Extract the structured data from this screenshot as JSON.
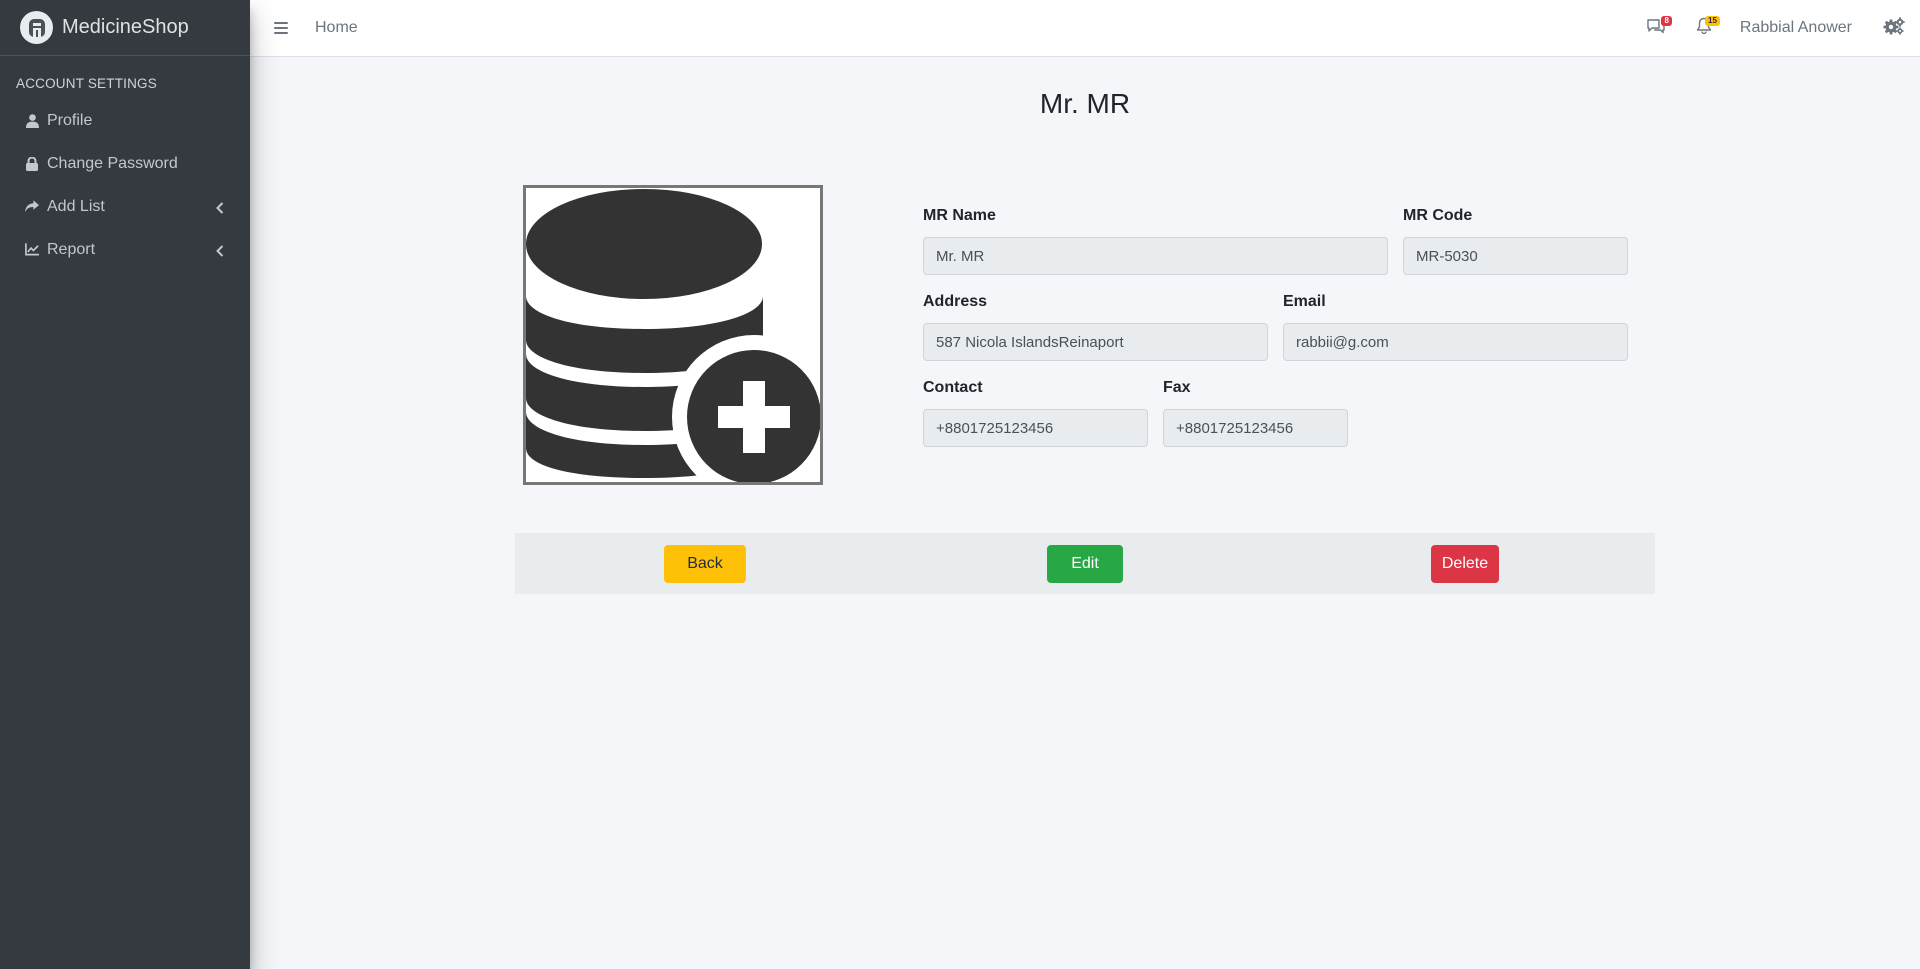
{
  "brand": {
    "name": "MedicineShop"
  },
  "sidebar": {
    "header": "ACCOUNT SETTINGS",
    "items": [
      {
        "label": "Profile",
        "icon": "user-icon"
      },
      {
        "label": "Change Password",
        "icon": "lock-icon"
      },
      {
        "label": "Add List",
        "icon": "share-icon",
        "has_submenu": true
      },
      {
        "label": "Report",
        "icon": "chart-line-icon",
        "has_submenu": true
      }
    ]
  },
  "topbar": {
    "home": "Home",
    "messages_badge": "8",
    "notifications_badge": "15",
    "user_name": "Rabbial Anower"
  },
  "page": {
    "title": "Mr. MR"
  },
  "form": {
    "mr_name": {
      "label": "MR Name",
      "value": "Mr. MR"
    },
    "mr_code": {
      "label": "MR Code",
      "value": "MR-5030"
    },
    "address": {
      "label": "Address",
      "value": "587 Nicola IslandsReinaport"
    },
    "email": {
      "label": "Email",
      "value": "rabbii@g.com"
    },
    "contact": {
      "label": "Contact",
      "value": "+8801725123456"
    },
    "fax": {
      "label": "Fax",
      "value": "+8801725123456"
    }
  },
  "actions": {
    "back": "Back",
    "edit": "Edit",
    "delete": "Delete"
  },
  "colors": {
    "sidebar_bg": "#343a40",
    "back": "#ffc107",
    "edit": "#28a745",
    "delete": "#dc3545"
  }
}
